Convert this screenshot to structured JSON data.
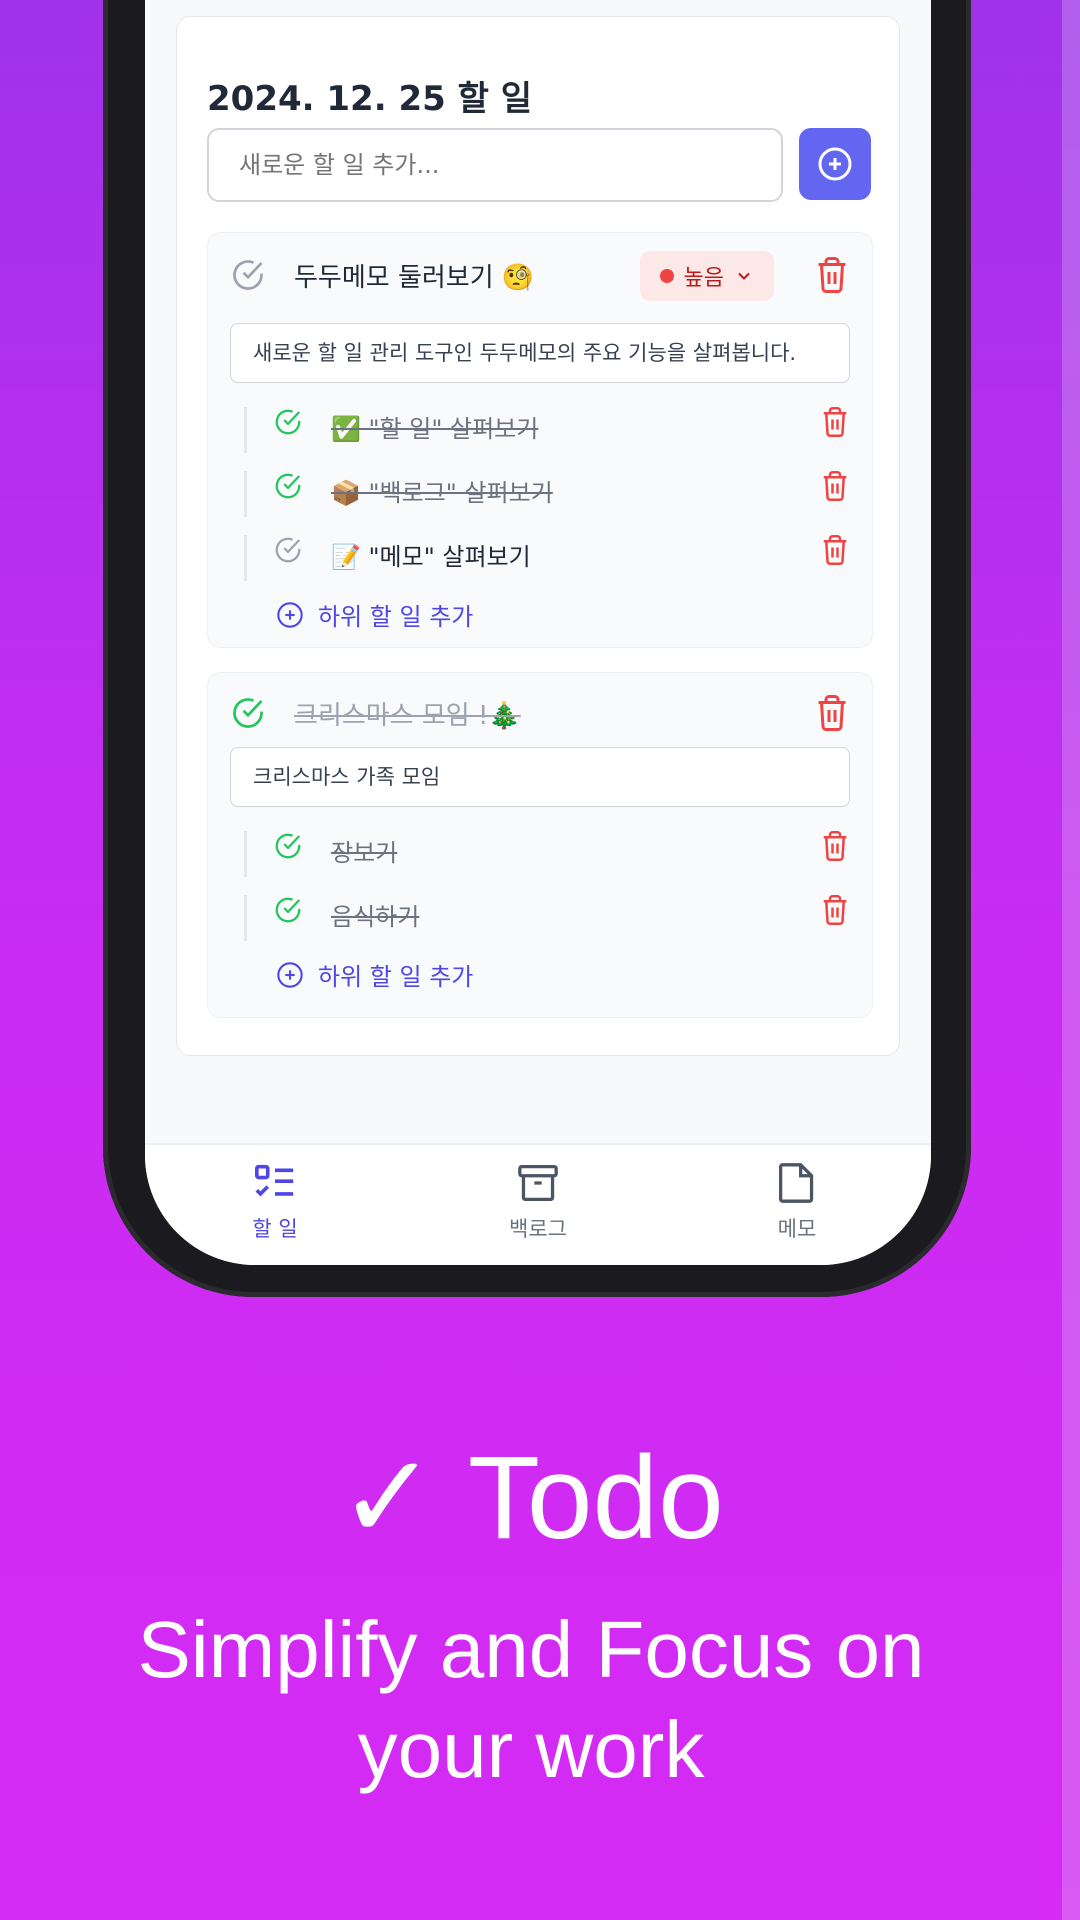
{
  "colors": {
    "accent": "#6366f1",
    "done_green": "#22c55e",
    "danger": "#ef4444",
    "background_top": "#a032ea",
    "background_bottom": "#d62bf4"
  },
  "todo": {
    "date_title": "2024. 12. 25 할 일",
    "new_task_placeholder": "새로운 할 일 추가...",
    "add_button_icon": "plus-circle-icon"
  },
  "tasks": [
    {
      "title": "두두메모 둘러보기 🧐",
      "done": false,
      "priority": "높음",
      "description": "새로운 할 일 관리 도구인 두두메모의 주요 기능을 살펴봅니다.",
      "subtasks": [
        {
          "title": "✅ \"할 일\" 살펴보기",
          "done": true
        },
        {
          "title": "📦 \"백로그\" 살펴보기",
          "done": true
        },
        {
          "title": "📝 \"메모\" 살펴보기",
          "done": false
        }
      ],
      "add_subtask_label": "하위 할 일 추가"
    },
    {
      "title": "크리스마스 모임 !🎄",
      "done": true,
      "description": "크리스마스 가족 모임",
      "subtasks": [
        {
          "title": "장보기",
          "done": true
        },
        {
          "title": "음식하기",
          "done": true
        }
      ],
      "add_subtask_label": "하위 할 일 추가"
    }
  ],
  "nav": {
    "items": [
      {
        "label": "할 일",
        "icon": "list-check-icon",
        "active": true
      },
      {
        "label": "백로그",
        "icon": "archive-icon",
        "active": false
      },
      {
        "label": "메모",
        "icon": "note-icon",
        "active": false
      }
    ]
  },
  "promo": {
    "headline": "✓ Todo",
    "tagline_line1": "Simplify and Focus on",
    "tagline_line2": "your work"
  }
}
